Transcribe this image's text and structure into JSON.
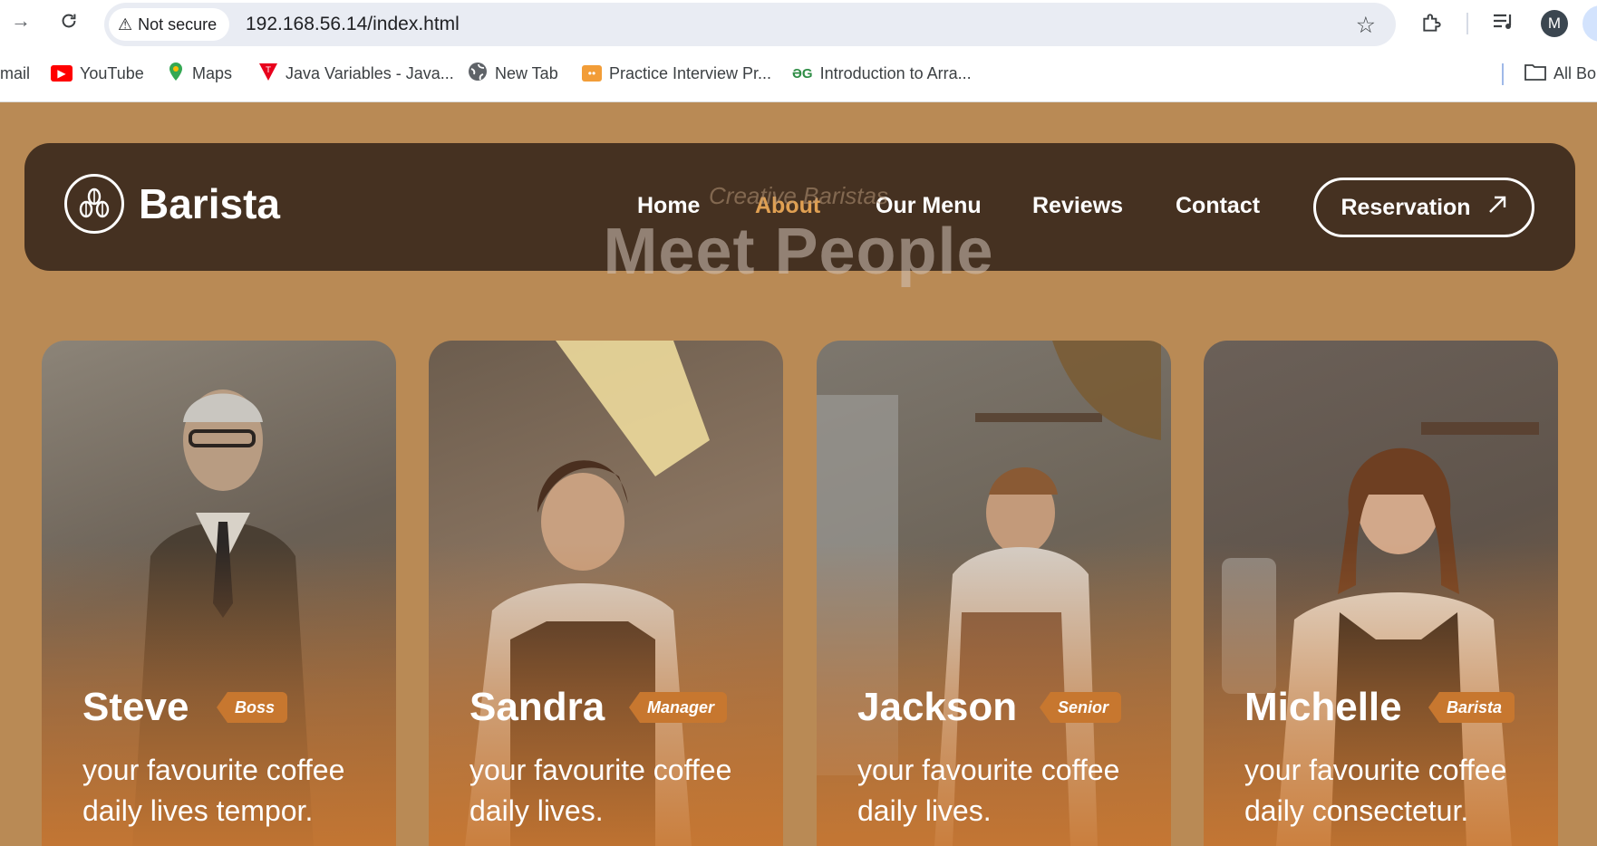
{
  "browser": {
    "security_label": "Not secure",
    "url": "192.168.56.14/index.html",
    "profile_initial": "M",
    "bookmarks": [
      {
        "label": "mail",
        "icon": "gmail-icon"
      },
      {
        "label": "YouTube",
        "icon": "youtube-icon"
      },
      {
        "label": "Maps",
        "icon": "maps-icon"
      },
      {
        "label": "Java Variables - Java...",
        "icon": "tpoint-icon"
      },
      {
        "label": "New Tab",
        "icon": "globe-icon"
      },
      {
        "label": "Practice Interview Pr...",
        "icon": "codechef-icon"
      },
      {
        "label": "Introduction to Arra...",
        "icon": "gfg-icon"
      },
      {
        "label": "All Bo",
        "icon": "folder-icon"
      }
    ]
  },
  "site": {
    "brand": "Barista",
    "nav": [
      "Home",
      "About",
      "Our Menu",
      "Reviews",
      "Contact"
    ],
    "active_nav": "About",
    "reservation_label": "Reservation",
    "eyebrow": "Creative Baristas",
    "heading": "Meet People"
  },
  "team": [
    {
      "name": "Steve",
      "role": "Boss",
      "desc": "your favourite coffee daily lives tempor."
    },
    {
      "name": "Sandra",
      "role": "Manager",
      "desc": "your favourite coffee daily lives."
    },
    {
      "name": "Jackson",
      "role": "Senior",
      "desc": "your favourite coffee daily lives."
    },
    {
      "name": "Michelle",
      "role": "Barista",
      "desc": "your favourite coffee daily consectetur."
    }
  ],
  "colors": {
    "page_bg": "#b98a55",
    "nav_bg": "#453121",
    "accent": "#e0a052",
    "badge": "#c7772f"
  }
}
